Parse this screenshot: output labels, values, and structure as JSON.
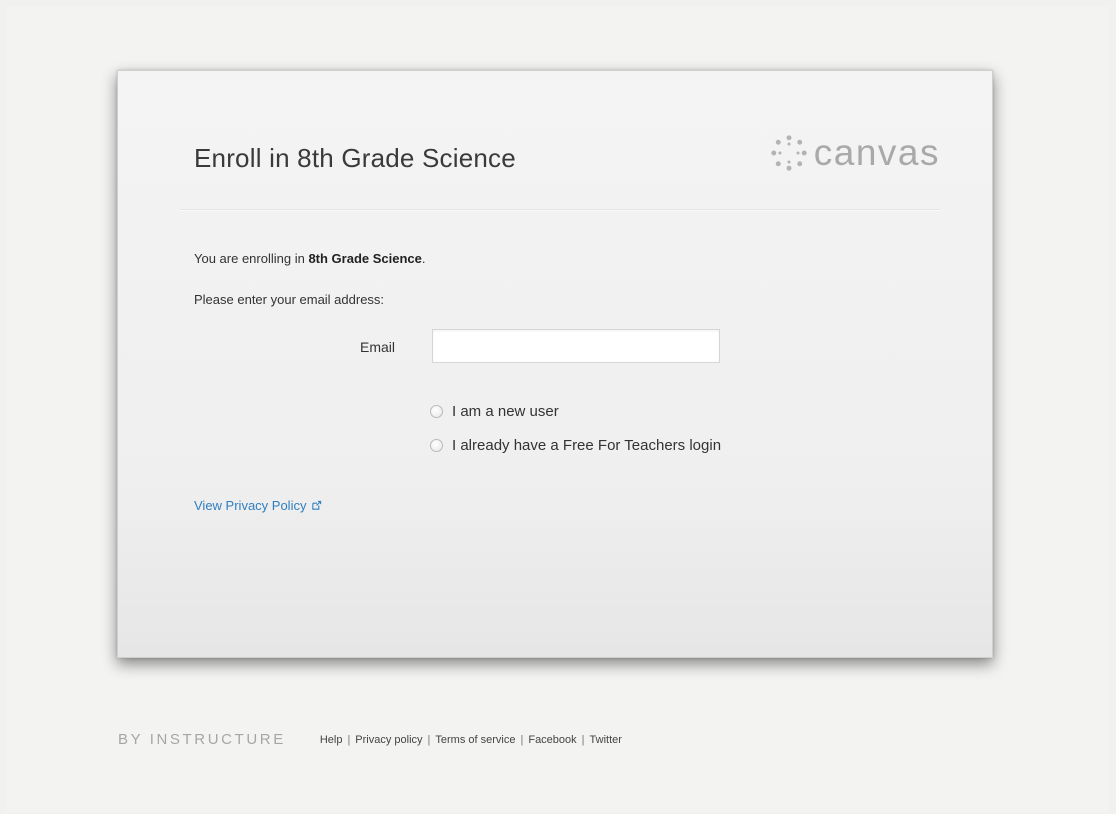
{
  "header": {
    "title": "Enroll in 8th Grade Science",
    "logo_text": "canvas",
    "logo_icon": "canvas-logo-icon"
  },
  "intro": {
    "prefix": "You are enrolling in ",
    "course": "8th Grade Science",
    "suffix": "."
  },
  "prompt": "Please enter your email address:",
  "email": {
    "label": "Email",
    "value": "",
    "placeholder": ""
  },
  "options": [
    {
      "label": "I am a new user",
      "checked": false
    },
    {
      "label": "I already have a Free For Teachers login",
      "checked": false
    }
  ],
  "privacy_link": {
    "label": "View Privacy Policy",
    "icon": "external-link-icon"
  },
  "footer": {
    "brand": "BY INSTRUCTURE",
    "links": [
      "Help",
      "Privacy policy",
      "Terms of service",
      "Facebook",
      "Twitter"
    ]
  },
  "colors": {
    "link": "#2f7fc0",
    "logo": "#a9a9a9",
    "background": "#f1f1f0"
  }
}
